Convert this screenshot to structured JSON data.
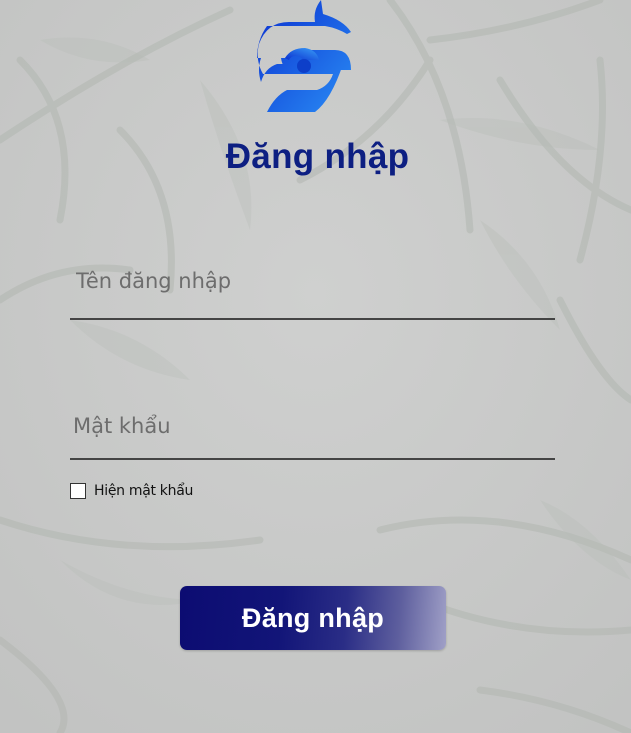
{
  "title": "Đăng nhập",
  "username": {
    "value": "",
    "placeholder": "Tên đăng nhập"
  },
  "password": {
    "value": "",
    "placeholder": "Mật khẩu"
  },
  "show_password": {
    "label": "Hiện mật khẩu",
    "checked": false
  },
  "login_button": {
    "label": "Đăng nhập"
  },
  "logo": {
    "icon": "company-logo-icon",
    "colors": [
      "#0a3fd6",
      "#1e88f0"
    ]
  },
  "colors": {
    "title": "#0d1f82",
    "button_start": "#0c0c72",
    "button_end": "#a0a0c7",
    "background": "#c9cac9"
  }
}
